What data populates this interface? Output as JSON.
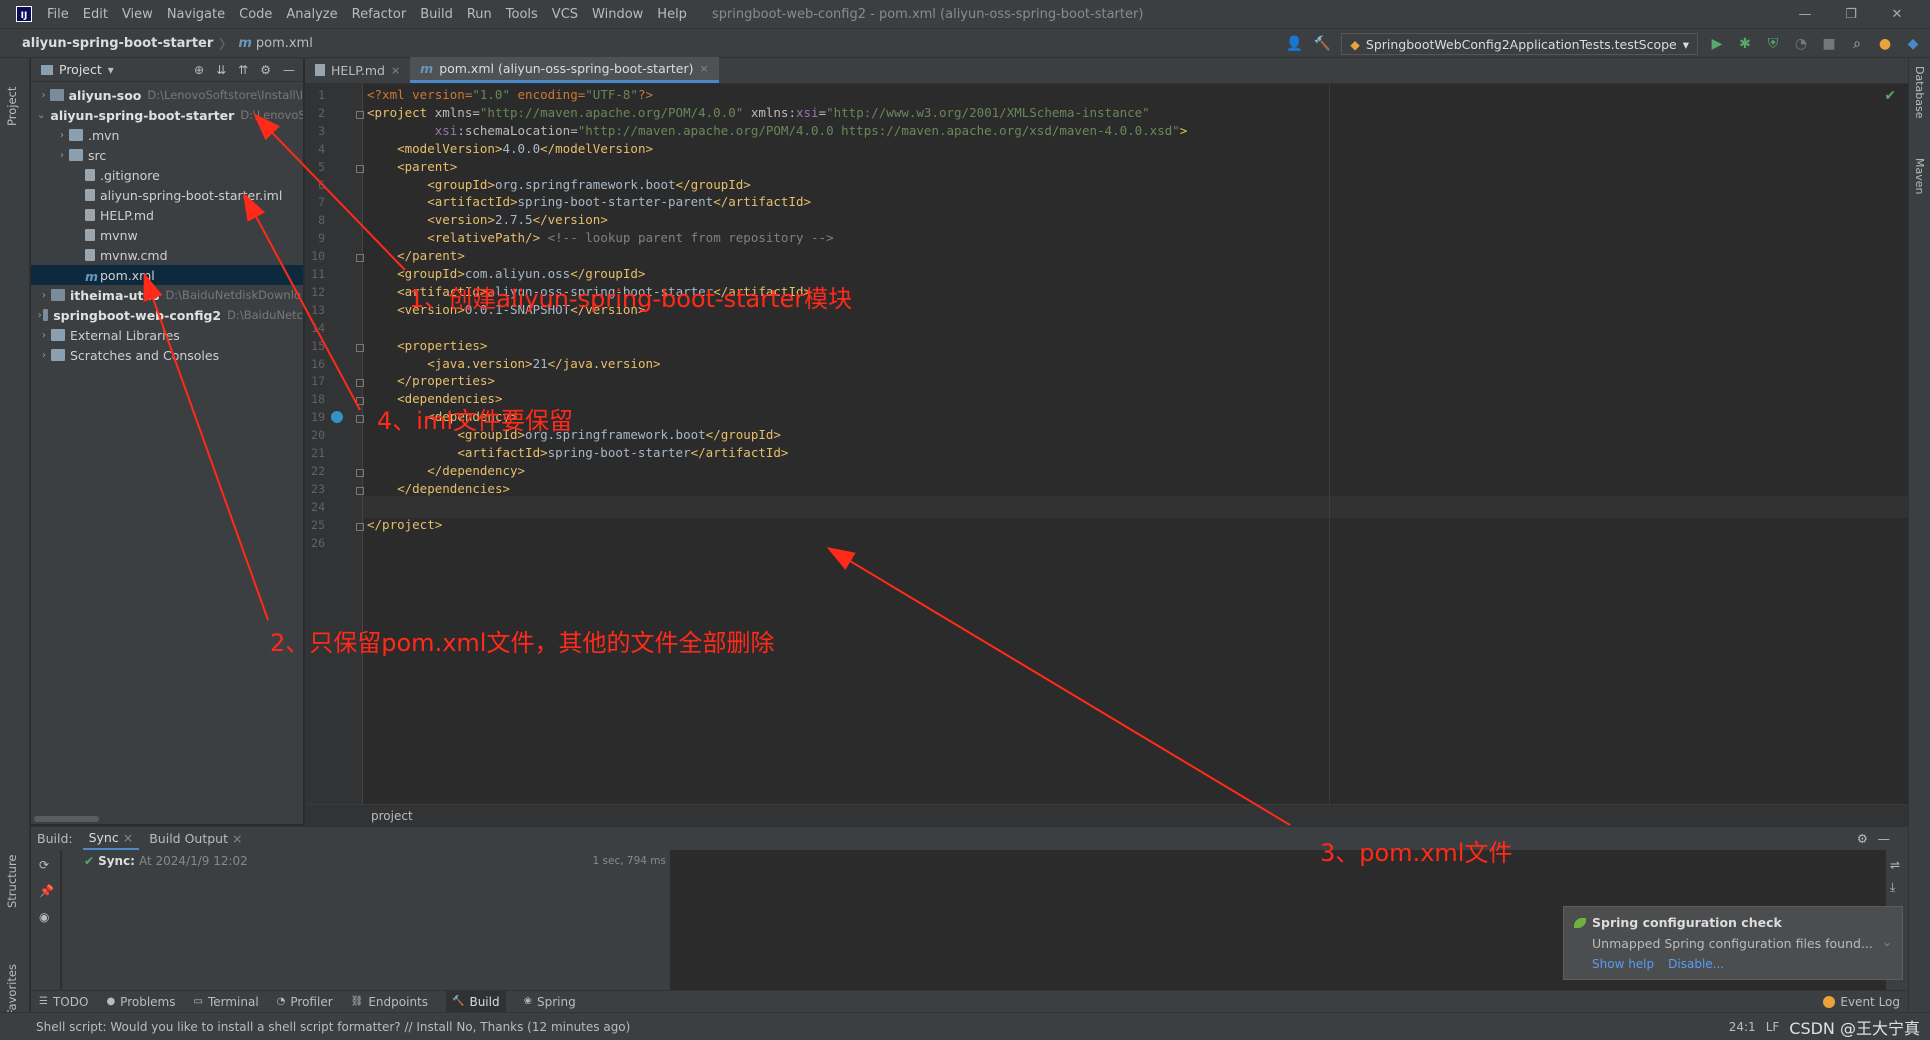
{
  "menubar": {
    "items": [
      "File",
      "Edit",
      "View",
      "Navigate",
      "Code",
      "Analyze",
      "Refactor",
      "Build",
      "Run",
      "Tools",
      "VCS",
      "Window",
      "Help"
    ],
    "window_title": "springboot-web-config2 - pom.xml (aliyun-oss-spring-boot-starter)",
    "logo": "IJ"
  },
  "navbar": {
    "project": "aliyun-spring-boot-starter",
    "file": "pom.xml",
    "run_config": "SpringbootWebConfig2ApplicationTests.testScope"
  },
  "left_strip": {
    "project_label": "Project",
    "structure_label": "Structure",
    "favorites_label": "Favorites"
  },
  "right_strip": {
    "database_label": "Database",
    "maven_label": "Maven"
  },
  "project_panel": {
    "title": "Project",
    "tree": [
      {
        "label": "aliyun-soo",
        "path": "D:\\LenovoSoftstore\\Install\\I",
        "bold": true,
        "level": 0,
        "chev": "›"
      },
      {
        "label": "aliyun-spring-boot-starter",
        "path": "D:\\LenovoS",
        "bold": true,
        "level": 0,
        "chev": "⌄"
      },
      {
        "label": ".mvn",
        "path": "",
        "bold": false,
        "level": 1,
        "chev": "›"
      },
      {
        "label": "src",
        "path": "",
        "bold": false,
        "level": 1,
        "chev": "›"
      },
      {
        "label": ".gitignore",
        "path": "",
        "bold": false,
        "level": 2,
        "chev": ""
      },
      {
        "label": "aliyun-spring-boot-starter.iml",
        "path": "",
        "bold": false,
        "level": 2,
        "chev": ""
      },
      {
        "label": "HELP.md",
        "path": "",
        "bold": false,
        "level": 2,
        "chev": ""
      },
      {
        "label": "mvnw",
        "path": "",
        "bold": false,
        "level": 2,
        "chev": ""
      },
      {
        "label": "mvnw.cmd",
        "path": "",
        "bold": false,
        "level": 2,
        "chev": ""
      },
      {
        "label": "pom.xml",
        "path": "",
        "bold": false,
        "level": 2,
        "chev": "",
        "selected": true
      },
      {
        "label": "itheima-utils",
        "path": "D:\\BaiduNetdiskDownlo",
        "bold": true,
        "level": 0,
        "chev": "›"
      },
      {
        "label": "springboot-web-config2",
        "path": "D:\\BaiduNetc",
        "bold": true,
        "level": 0,
        "chev": "›"
      },
      {
        "label": "External Libraries",
        "path": "",
        "bold": false,
        "level": 0,
        "chev": "›"
      },
      {
        "label": "Scratches and Consoles",
        "path": "",
        "bold": false,
        "level": 0,
        "chev": "›"
      }
    ]
  },
  "editor_tabs": [
    {
      "label": "HELP.md",
      "active": false
    },
    {
      "label": "pom.xml (aliyun-oss-spring-boot-starter)",
      "active": true
    }
  ],
  "editor": {
    "line_numbers": [
      "1",
      "2",
      "3",
      "4",
      "5",
      "6",
      "7",
      "8",
      "9",
      "10",
      "11",
      "12",
      "13",
      "14",
      "15",
      "16",
      "17",
      "18",
      "19",
      "20",
      "21",
      "22",
      "23",
      "24",
      "25",
      "26"
    ],
    "lines": [
      [
        [
          "pi",
          "<?xml version="
        ],
        [
          "val",
          "\"1.0\""
        ],
        [
          "pi",
          " encoding="
        ],
        [
          "val",
          "\"UTF-8\""
        ],
        [
          "pi",
          "?>"
        ]
      ],
      [
        [
          "tag",
          "<project "
        ],
        [
          "attr",
          "xmlns="
        ],
        [
          "val",
          "\"http://maven.apache.org/POM/4.0.0\""
        ],
        [
          "attr",
          " xmlns:"
        ],
        [
          "ns",
          "xsi"
        ],
        [
          "attr",
          "="
        ],
        [
          "val",
          "\"http://www.w3.org/2001/XMLSchema-instance\""
        ]
      ],
      [
        [
          "attr",
          "         "
        ],
        [
          "ns",
          "xsi"
        ],
        [
          "attr",
          ":schemaLocation="
        ],
        [
          "val",
          "\"http://maven.apache.org/POM/4.0.0 https://maven.apache.org/xsd/maven-4.0.0.xsd\""
        ],
        [
          "tag",
          ">"
        ]
      ],
      [
        [
          "text",
          "    "
        ],
        [
          "tag",
          "<modelVersion>"
        ],
        [
          "text",
          "4.0.0"
        ],
        [
          "tag",
          "</modelVersion>"
        ]
      ],
      [
        [
          "text",
          "    "
        ],
        [
          "tag",
          "<parent>"
        ]
      ],
      [
        [
          "text",
          "        "
        ],
        [
          "tag",
          "<groupId>"
        ],
        [
          "text",
          "org.springframework.boot"
        ],
        [
          "tag",
          "</groupId>"
        ]
      ],
      [
        [
          "text",
          "        "
        ],
        [
          "tag",
          "<artifactId>"
        ],
        [
          "text",
          "spring-boot-starter-parent"
        ],
        [
          "tag",
          "</artifactId>"
        ]
      ],
      [
        [
          "text",
          "        "
        ],
        [
          "tag",
          "<version>"
        ],
        [
          "text",
          "2.7.5"
        ],
        [
          "tag",
          "</version>"
        ]
      ],
      [
        [
          "text",
          "        "
        ],
        [
          "tag",
          "<relativePath/>"
        ],
        [
          "cmt",
          " <!-- lookup parent from repository -->"
        ]
      ],
      [
        [
          "text",
          "    "
        ],
        [
          "tag",
          "</parent>"
        ]
      ],
      [
        [
          "text",
          "    "
        ],
        [
          "tag",
          "<groupId>"
        ],
        [
          "text",
          "com.aliyun.oss"
        ],
        [
          "tag",
          "</groupId>"
        ]
      ],
      [
        [
          "text",
          "    "
        ],
        [
          "tag",
          "<artifactId>"
        ],
        [
          "text",
          "aliyun-oss-spring-boot-starter"
        ],
        [
          "tag",
          "</artifactId>"
        ]
      ],
      [
        [
          "text",
          "    "
        ],
        [
          "tag",
          "<version>"
        ],
        [
          "text",
          "0.0.1-SNAPSHOT"
        ],
        [
          "tag",
          "</version>"
        ]
      ],
      [
        [
          "text",
          ""
        ]
      ],
      [
        [
          "text",
          "    "
        ],
        [
          "tag",
          "<properties>"
        ]
      ],
      [
        [
          "text",
          "        "
        ],
        [
          "tag",
          "<java.version>"
        ],
        [
          "text",
          "21"
        ],
        [
          "tag",
          "</java.version>"
        ]
      ],
      [
        [
          "text",
          "    "
        ],
        [
          "tag",
          "</properties>"
        ]
      ],
      [
        [
          "text",
          "    "
        ],
        [
          "tag",
          "<dependencies>"
        ]
      ],
      [
        [
          "text",
          "        "
        ],
        [
          "tag",
          "<dependency>"
        ]
      ],
      [
        [
          "text",
          "            "
        ],
        [
          "tag",
          "<groupId>"
        ],
        [
          "text",
          "org.springframework.boot"
        ],
        [
          "tag",
          "</groupId>"
        ]
      ],
      [
        [
          "text",
          "            "
        ],
        [
          "tag",
          "<artifactId>"
        ],
        [
          "text",
          "spring-boot-starter"
        ],
        [
          "tag",
          "</artifactId>"
        ]
      ],
      [
        [
          "text",
          "        "
        ],
        [
          "tag",
          "</dependency>"
        ]
      ],
      [
        [
          "text",
          "    "
        ],
        [
          "tag",
          "</dependencies>"
        ]
      ],
      [
        [
          "text",
          ""
        ]
      ],
      [
        [
          "tag",
          "</project>"
        ]
      ],
      [
        [
          "text",
          ""
        ]
      ]
    ],
    "breadcrumb": "project"
  },
  "build": {
    "label": "Build:",
    "tab_sync": "Sync",
    "tab_output": "Build Output",
    "sync_label": "Sync:",
    "sync_at": "At 2024/1/9 12:02",
    "sync_time": "1 sec, 794 ms"
  },
  "notification": {
    "title": "Spring configuration check",
    "body": "Unmapped Spring configuration files found...",
    "link1": "Show help",
    "link2": "Disable..."
  },
  "toolbar": {
    "items": [
      "TODO",
      "Problems",
      "Terminal",
      "Profiler",
      "Endpoints",
      "Build",
      "Spring"
    ],
    "event_log": "Event Log"
  },
  "statusbar": {
    "message": "Shell script: Would you like to install a shell script formatter? // Install   No, Thanks (12 minutes ago)",
    "position": "24:1",
    "line_sep": "LF",
    "watermark": "CSDN @王大宁真"
  },
  "annotations": [
    {
      "text": "1、创建aliyun-spring-boot-starter模块"
    },
    {
      "text": "4、iml文件要保留"
    },
    {
      "text": "2、只保留pom.xml文件，其他的文件全部删除"
    },
    {
      "text": "3、pom.xml文件"
    }
  ],
  "colors": {
    "accent": "#4a88c7",
    "annotation": "#ff2a1a",
    "ok": "#59a869"
  }
}
